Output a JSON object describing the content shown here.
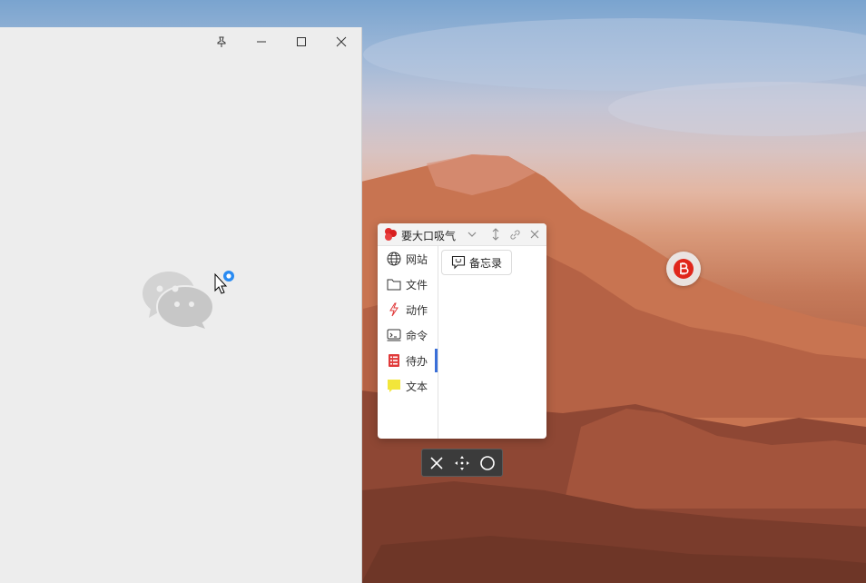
{
  "wallpaper": {
    "description_icon": "mountain-landscape"
  },
  "wechat_window": {
    "controls": {
      "pin_icon": "pin-icon",
      "minimize_icon": "minimize-icon",
      "maximize_icon": "maximize-icon",
      "close_icon": "close-icon"
    },
    "logo_icon": "wechat-logo-icon"
  },
  "launcher_panel": {
    "title": "要大口吸气",
    "header_icons": [
      "chevron-down-icon",
      "resize-vertical-icon",
      "link-icon",
      "close-icon"
    ],
    "sidebar": {
      "items": [
        {
          "label": "网站",
          "icon": "globe-icon"
        },
        {
          "label": "文件",
          "icon": "folder-icon"
        },
        {
          "label": "动作",
          "icon": "lightning-icon"
        },
        {
          "label": "命令",
          "icon": "terminal-icon"
        },
        {
          "label": "待办",
          "icon": "todo-list-icon",
          "active": true
        },
        {
          "label": "文本",
          "icon": "note-icon"
        }
      ]
    },
    "content": {
      "items": [
        {
          "label": "备忘录",
          "icon": "memo-chat-icon"
        }
      ]
    }
  },
  "floating_toolbar": {
    "icons": [
      "close-icon",
      "move-icon",
      "circle-icon"
    ]
  },
  "floating_ball": {
    "icon": "bitcoin-icon"
  },
  "colors": {
    "accent": "#3a6fd8",
    "panel_bg": "#ffffff",
    "wechat_bg": "#ededed",
    "ball_red": "#e0261b"
  }
}
